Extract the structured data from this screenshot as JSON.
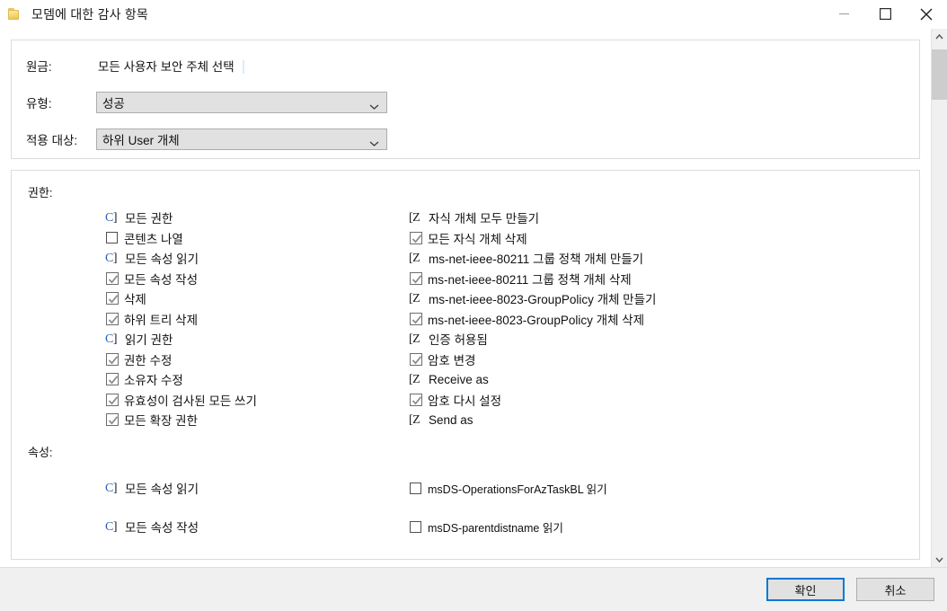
{
  "window": {
    "title": "모뎀에 대한 감사 항목",
    "icon": "folder-icon",
    "controls": {
      "minimize": "최소화",
      "maximize": "최대화",
      "close": "닫기"
    }
  },
  "form": {
    "principal": {
      "label": "원금:",
      "value": "모든 사용자 보안 주체 선택"
    },
    "type": {
      "label": "유형:",
      "value": "성공"
    },
    "applies_to": {
      "label": "적용 대상:",
      "value": "하위 User 개체"
    }
  },
  "permissions": {
    "title": "권한:",
    "left": [
      {
        "label": "모든 권한",
        "state": "glyph-c"
      },
      {
        "label": "콘텐츠 나열",
        "state": "empty"
      },
      {
        "label": "모든 속성 읽기",
        "state": "glyph-c"
      },
      {
        "label": "모든 속성 작성",
        "state": "checked"
      },
      {
        "label": "삭제",
        "state": "checked"
      },
      {
        "label": "하위 트리 삭제",
        "state": "checked"
      },
      {
        "label": "읽기 권한",
        "state": "glyph-c"
      },
      {
        "label": "권한 수정",
        "state": "checked"
      },
      {
        "label": "소유자 수정",
        "state": "checked"
      },
      {
        "label": "유효성이 검사된 모든 쓰기",
        "state": "checked"
      },
      {
        "label": "모든 확장 권한",
        "state": "checked"
      }
    ],
    "right": [
      {
        "label": "자식 개체 모두 만들기",
        "state": "glyph-z"
      },
      {
        "label": "모든 자식 개체 삭제",
        "state": "checked"
      },
      {
        "label": "ms-net-ieee-80211 그룹 정책 개체 만들기",
        "state": "glyph-z"
      },
      {
        "label": "ms-net-ieee-80211 그룹 정책 개체 삭제",
        "state": "checked"
      },
      {
        "label": "ms-net-ieee-8023-GroupPolicy 개체 만들기",
        "state": "glyph-z"
      },
      {
        "label": "ms-net-ieee-8023-GroupPolicy 개체 삭제",
        "state": "checked"
      },
      {
        "label": "인증 허용됨",
        "state": "glyph-z"
      },
      {
        "label": "암호 변경",
        "state": "checked"
      },
      {
        "label": "Receive as",
        "state": "glyph-z"
      },
      {
        "label": "암호 다시 설정",
        "state": "checked"
      },
      {
        "label": "Send as",
        "state": "glyph-z"
      }
    ]
  },
  "properties": {
    "title": "속성:",
    "left": [
      {
        "label": "모든 속성 읽기",
        "state": "glyph-c"
      },
      {
        "label": "모든 속성 작성",
        "state": "glyph-c"
      }
    ],
    "right": [
      {
        "label": "msDS-OperationsForAzTaskBL 읽기",
        "state": "empty"
      },
      {
        "label": "msDS-parentdistname 읽기",
        "state": "empty"
      }
    ]
  },
  "footer": {
    "ok_label": "확인",
    "cancel_label": "취소"
  },
  "scrollbar": {
    "up_arrow": "chevron-up-icon",
    "down_arrow": "chevron-down-icon"
  },
  "colors": {
    "accent": "#0078d7",
    "glyph_blue": "#2b5fb3",
    "combo_bg": "#e1e1e1",
    "footer_bg": "#f0f0f0"
  }
}
